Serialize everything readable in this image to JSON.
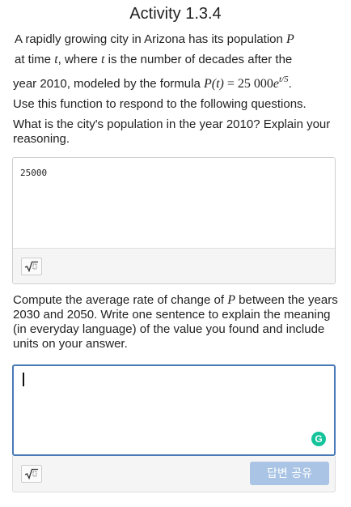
{
  "activity": {
    "title": "Activity 1.3.4"
  },
  "intro": {
    "line1_text": "A rapidly growing city in Arizona has its population ",
    "line1_var": "P",
    "line2_pre": "at time ",
    "line2_var1": "t",
    "line2_mid": ", where ",
    "line2_var2": "t",
    "line2_post": " is the number of decades after the",
    "line3_text": "year 2010, modeled by the formula ",
    "formula_lhs": "P(t)",
    "formula_eq": " = 25 000",
    "formula_e": "e",
    "formula_exp": "t/5",
    "formula_end": ".",
    "line4_text": "Use this function to respond to the following questions."
  },
  "question1": {
    "prompt": "What is the city's population in the year 2010?  Explain your reasoning.",
    "answer_value": "25000"
  },
  "question2": {
    "prompt_pre": "Compute the average rate of change of ",
    "prompt_var": "P",
    "prompt_post": " between the years 2030 and 2050. Write one sentence to explain the meaning (in everyday language) of the value you found and include units on your answer.",
    "answer_value": "",
    "share_button_label": "답변 공유",
    "grammarly_label": "G"
  },
  "icons": {
    "math_icon": "square-root-icon",
    "grammarly_icon": "grammarly-icon"
  },
  "colors": {
    "editor_focus_border": "#4a79b8",
    "share_button_bg": "#a9c4e4",
    "grammarly_green": "#15c39a"
  }
}
